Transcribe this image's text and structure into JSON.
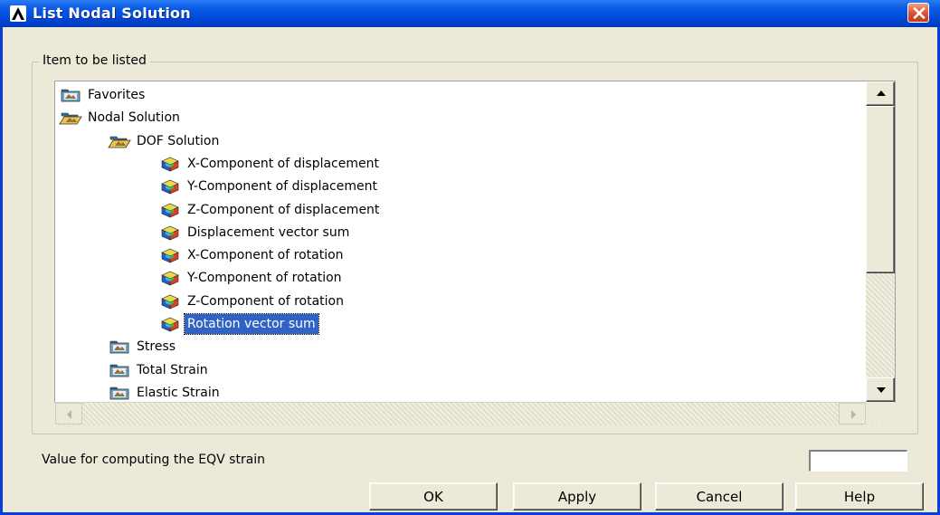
{
  "window": {
    "title": "List Nodal Solution",
    "close_label": "close"
  },
  "group": {
    "legend": "Item to be listed"
  },
  "tree": {
    "items": [
      {
        "label": "Favorites",
        "icon": "folder-closed-icon",
        "level": 0
      },
      {
        "label": "Nodal Solution",
        "icon": "folder-open-icon",
        "level": 0
      },
      {
        "label": "DOF Solution",
        "icon": "folder-open-icon",
        "level": 1
      },
      {
        "label": "X-Component of displacement",
        "icon": "result-cube-icon",
        "level": 2
      },
      {
        "label": "Y-Component of displacement",
        "icon": "result-cube-icon",
        "level": 2
      },
      {
        "label": "Z-Component of displacement",
        "icon": "result-cube-icon",
        "level": 2
      },
      {
        "label": "Displacement vector sum",
        "icon": "result-cube-icon",
        "level": 2
      },
      {
        "label": "X-Component of rotation",
        "icon": "result-cube-icon",
        "level": 2
      },
      {
        "label": "Y-Component of rotation",
        "icon": "result-cube-icon",
        "level": 2
      },
      {
        "label": "Z-Component of rotation",
        "icon": "result-cube-icon",
        "level": 2
      },
      {
        "label": "Rotation vector sum",
        "icon": "result-cube-icon",
        "level": 2,
        "selected": true
      },
      {
        "label": "Stress",
        "icon": "folder-closed-icon",
        "level": 1
      },
      {
        "label": "Total Strain",
        "icon": "folder-closed-icon",
        "level": 1
      },
      {
        "label": "Elastic Strain",
        "icon": "folder-closed-icon",
        "level": 1
      }
    ]
  },
  "eqv": {
    "label": "Value for computing the EQV strain",
    "value": ""
  },
  "buttons": {
    "ok": "OK",
    "apply": "Apply",
    "cancel": "Cancel",
    "help": "Help"
  },
  "colors": {
    "titlebar": "#0047D6",
    "selection": "#3163C5",
    "dialog_bg": "#ECE9D8"
  }
}
